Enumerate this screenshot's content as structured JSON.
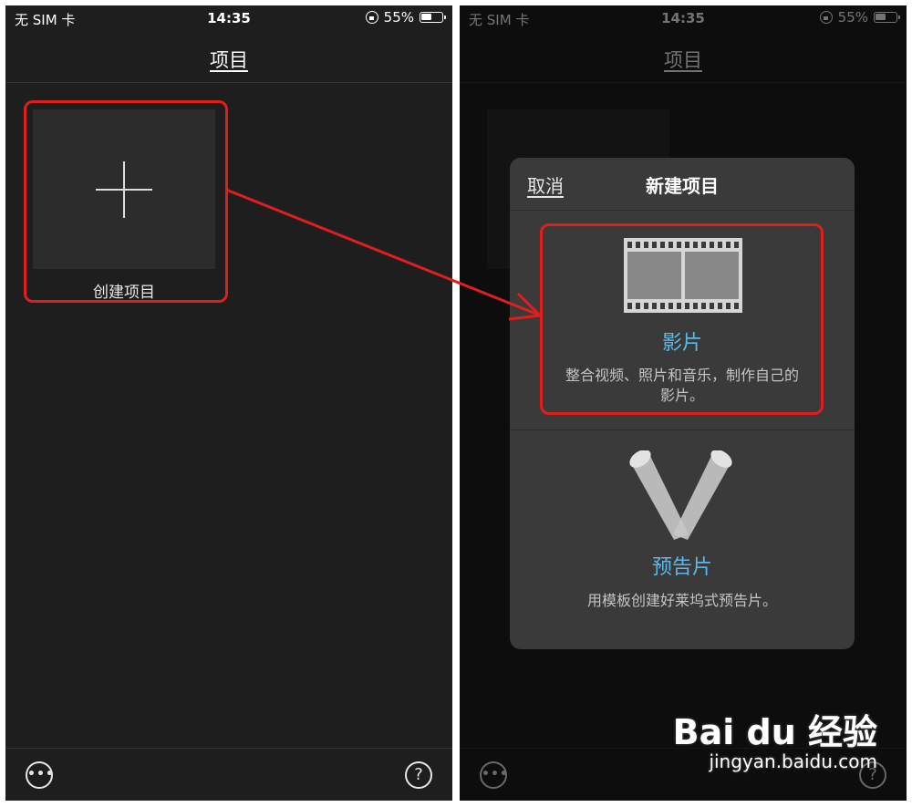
{
  "status_bar": {
    "carrier": "无 SIM 卡",
    "time": "14:35",
    "battery": "55%",
    "battery_level": 0.55
  },
  "header": {
    "title": "项目"
  },
  "create_tile": {
    "label": "创建项目"
  },
  "sheet": {
    "cancel_label": "取消",
    "title": "新建项目",
    "options": [
      {
        "title": "影片",
        "description": "整合视频、照片和音乐，制作自己的影片。"
      },
      {
        "title": "预告片",
        "description": "用模板创建好莱坞式预告片。"
      }
    ]
  },
  "toolbar": {
    "more_symbol": "•••",
    "help_symbol": "?"
  },
  "watermark": {
    "logo": "Bai du 经验",
    "url": "jingyan.baidu.com"
  },
  "colors": {
    "accent": "#5db8ea",
    "annotation": "#e01e1e",
    "background": "#1e1e1e",
    "sheet": "#3a3a3a"
  },
  "icons": [
    "plus-icon",
    "film-strip-icon",
    "spotlight-icon",
    "more-icon",
    "help-icon",
    "orientation-lock-icon",
    "battery-icon"
  ]
}
